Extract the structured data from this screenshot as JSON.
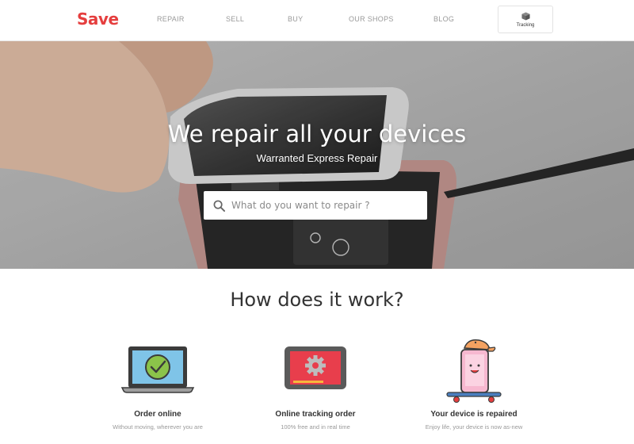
{
  "header": {
    "logo": "Save",
    "nav": [
      "REPAIR",
      "SELL",
      "BUY",
      "OUR SHOPS",
      "BLOG"
    ],
    "tracking_label": "Tracking",
    "tracking_icon": "box-icon"
  },
  "hero": {
    "title": "We repair all your devices",
    "subtitle": "Warranted Express Repair",
    "search_placeholder": "What do you want to repair ?",
    "search_icon": "search-icon"
  },
  "how": {
    "title": "How does it work?",
    "steps": [
      {
        "title": "Order online",
        "desc": "Without moving, wherever you are",
        "icon": "laptop-check-icon"
      },
      {
        "title": "Online tracking order",
        "desc": "100% free and in real time",
        "icon": "tablet-gear-icon"
      },
      {
        "title": "Your device is repaired",
        "desc": "Enjoy life, your device is now as-new",
        "icon": "happy-phone-skateboard-icon"
      }
    ]
  },
  "colors": {
    "brand": "#e53e3e",
    "check_green": "#8bc34a",
    "tablet_red": "#e83e4c",
    "phone_pink": "#f7b8d0",
    "hat_orange": "#f4a261"
  }
}
